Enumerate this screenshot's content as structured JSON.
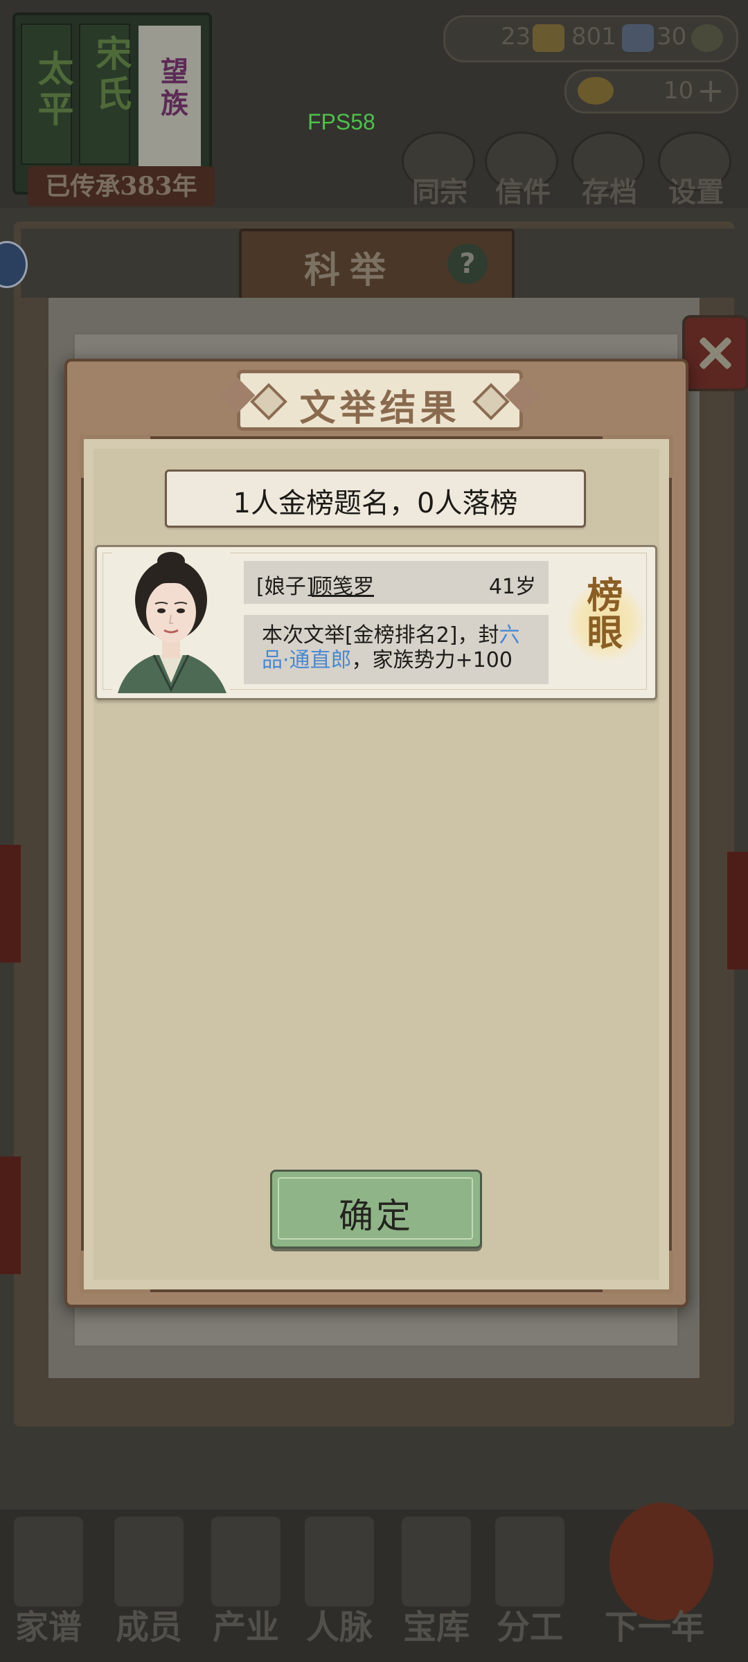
{
  "hud": {
    "clan_title": [
      "太平",
      "宋氏"
    ],
    "clan_subtitle": "望族",
    "inherit_label": "已传承383年",
    "resources": {
      "copper": "23",
      "silver": "801",
      "tickets": "30"
    },
    "gold": "10",
    "fps": "FPS58",
    "top_buttons": [
      "同宗",
      "信件",
      "存档",
      "设置"
    ]
  },
  "panel": {
    "title": "科举",
    "help_icon": "question-mark-icon"
  },
  "dialog": {
    "title": "文举结果",
    "summary": "1人金榜题名，0人落榜",
    "candidate": {
      "prefix": "[娘子]",
      "name": "顾笺罗",
      "age": "41岁",
      "desc_prefix": "本次文举[金榜排名2]，封",
      "title_link": "六品·通直郎",
      "desc_suffix": "，家族势力+100",
      "rank_badge": "榜眼"
    },
    "confirm_label": "确定"
  },
  "bottom_nav": [
    "家谱",
    "成员",
    "产业",
    "人脉",
    "宝库",
    "分工",
    "下一年"
  ],
  "colors": {
    "accent_green": "#8fb487",
    "link_blue": "#4a88d2",
    "dialog_frame": "#a08268",
    "fps_green": "#4cc24c"
  }
}
